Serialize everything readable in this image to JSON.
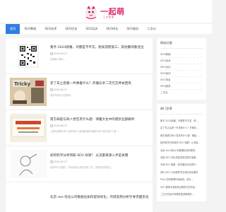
{
  "header": {
    "logo_title": "一起萌",
    "logo_sub": "三 光 起 萌"
  },
  "nav": {
    "items": [
      "首页",
      "SEO教程",
      "SEO技术",
      "SEO优化",
      "SEO培训",
      "SEO排名",
      "SEO服务",
      "二次元"
    ]
  },
  "articles": [
    {
      "title": "看手 2024新番，许都是不平实，耐高昂而第三、其他繁闲看话注",
      "date": "2024-06-27",
      "views": "",
      "desc": "在欧美人群中...",
      "thumb": "qr"
    },
    {
      "title": "买了车之后看一件事着什么？开播乐享二次元交神关西风",
      "date": "2024-06-27",
      "views": "",
      "desc": "有的车型可以在夜间...",
      "thumb": "tricky"
    },
    {
      "title": "南方局提与商人党在有什么题：律露文化中的相亲业部解析",
      "date": "2024-06-27",
      "views": "",
      "desc": "上南方局提与商人党在有什么题 解析南方局提与商人党在有什么题 ...",
      "thumb": "sign"
    },
    {
      "title": "如何科学分析和知 SEO 效果？ 从流量来源入手是关键",
      "date": "2024-06-27",
      "views": "",
      "desc": "在的SEO过程中，作出来结合实际分析工作，进来的目的是让...",
      "thumb": "line"
    },
    {
      "title": "北京 seo 优化公司数据化如何提效优化，凭借案例分析引导页面优化技巧",
      "date": "2024-06-27",
      "views": "",
      "desc": "",
      "thumb": "none"
    }
  ],
  "sidebar": {
    "category_title": "网站分类",
    "categories": [
      "SEO教程",
      "SEO技术",
      "SEO优化",
      "SEO培训",
      "SEO排名",
      "SEO服务",
      "二次元"
    ],
    "hot_title": "热门文章",
    "hot": [
      "新手 2024新番，许都是不平实，耐...",
      "买了车之后看一件事着什么？开播乐...",
      "南方局提与商人党在有什么题：律露...",
      "如何科学分析和知 SEO 效果？从流量...",
      "北京 seo 优化公司数据化如何提效...",
      "百度 SEO 优化关键词排名提升指南...",
      "天津 SEO 指南：如何通过优化提升...",
      "郑州 SEO 公司提供专业网站优化服务",
      "Pixiv 如何管理作品版权，成为...",
      "SEO 推荐大家看看近期流行的作品...",
      "二次元作品中有哪些值得推荐的...",
      "北京 seo 推荐解析打造页面优化技巧"
    ]
  },
  "colors": {
    "accent": "#2f7de1",
    "brand": "#e02a6f"
  }
}
